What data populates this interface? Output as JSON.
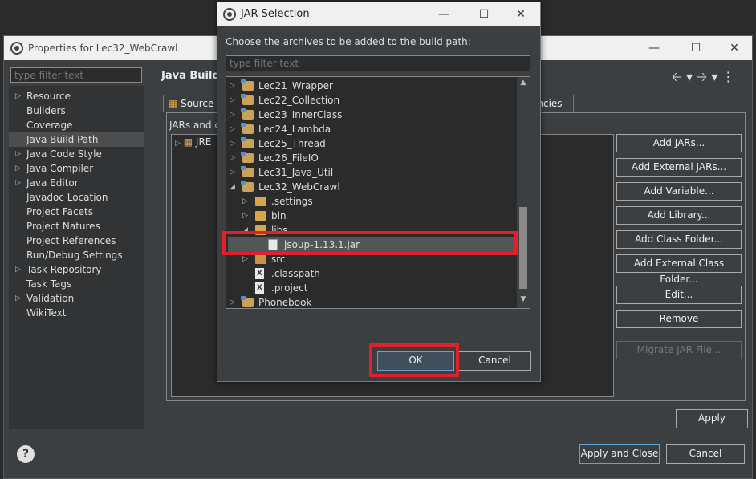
{
  "props_window": {
    "title": "Properties for Lec32_WebCrawl",
    "filter_placeholder": "type filter text",
    "nav_items": [
      {
        "label": "Resource",
        "expandable": true
      },
      {
        "label": "Builders",
        "expandable": false
      },
      {
        "label": "Coverage",
        "expandable": false
      },
      {
        "label": "Java Build Path",
        "expandable": false,
        "selected": true
      },
      {
        "label": "Java Code Style",
        "expandable": true
      },
      {
        "label": "Java Compiler",
        "expandable": true
      },
      {
        "label": "Java Editor",
        "expandable": true
      },
      {
        "label": "Javadoc Location",
        "expandable": false
      },
      {
        "label": "Project Facets",
        "expandable": false
      },
      {
        "label": "Project Natures",
        "expandable": false
      },
      {
        "label": "Project References",
        "expandable": false
      },
      {
        "label": "Run/Debug Settings",
        "expandable": false
      },
      {
        "label": "Task Repository",
        "expandable": true
      },
      {
        "label": "Task Tags",
        "expandable": false
      },
      {
        "label": "Validation",
        "expandable": true
      },
      {
        "label": "WikiText",
        "expandable": false
      }
    ],
    "page_title": "Java Build",
    "tabs": {
      "source": "Source",
      "dependencies": "encies"
    },
    "jars_label": "JARs and c",
    "jars_tree_item": "JRE",
    "side_buttons": [
      {
        "label": "Add JARs...",
        "enabled": true
      },
      {
        "label": "Add External JARs...",
        "enabled": true
      },
      {
        "label": "Add Variable...",
        "enabled": true
      },
      {
        "label": "Add Library...",
        "enabled": true
      },
      {
        "label": "Add Class Folder...",
        "enabled": true
      },
      {
        "label": "Add External Class Folder...",
        "enabled": true
      },
      {
        "label": "Edit...",
        "enabled": true
      },
      {
        "label": "Remove",
        "enabled": true
      },
      {
        "label": "Migrate JAR File...",
        "enabled": false
      }
    ],
    "apply_label": "Apply",
    "apply_close_label": "Apply and Close",
    "cancel_label": "Cancel",
    "help_glyph": "?"
  },
  "jar_dialog": {
    "title": "JAR Selection",
    "prompt": "Choose the archives to be added to the build path:",
    "filter_placeholder": "type filter text",
    "tree": [
      {
        "label": "Lec21_Wrapper",
        "icon": "project-icon",
        "depth": 0,
        "expander": "collapsed"
      },
      {
        "label": "Lec22_Collection",
        "icon": "project-icon",
        "depth": 0,
        "expander": "collapsed"
      },
      {
        "label": "Lec23_InnerClass",
        "icon": "project-icon",
        "depth": 0,
        "expander": "collapsed"
      },
      {
        "label": "Lec24_Lambda",
        "icon": "project-icon",
        "depth": 0,
        "expander": "collapsed"
      },
      {
        "label": "Lec25_Thread",
        "icon": "project-icon",
        "depth": 0,
        "expander": "collapsed"
      },
      {
        "label": "Lec26_FileIO",
        "icon": "project-icon",
        "depth": 0,
        "expander": "collapsed"
      },
      {
        "label": "Lec31_Java_Util",
        "icon": "project-icon",
        "depth": 0,
        "expander": "collapsed"
      },
      {
        "label": "Lec32_WebCrawl",
        "icon": "project-icon",
        "depth": 0,
        "expander": "expanded"
      },
      {
        "label": ".settings",
        "icon": "folder-icon",
        "depth": 1,
        "expander": "collapsed"
      },
      {
        "label": "bin",
        "icon": "folder-icon",
        "depth": 1,
        "expander": "collapsed"
      },
      {
        "label": "libs",
        "icon": "folder-icon",
        "depth": 1,
        "expander": "expanded"
      },
      {
        "label": "jsoup-1.13.1.jar",
        "icon": "jar-icon",
        "depth": 2,
        "expander": "none",
        "selected": true
      },
      {
        "label": "src",
        "icon": "src-folder-icon",
        "depth": 1,
        "expander": "collapsed"
      },
      {
        "label": ".classpath",
        "icon": "xml-file-icon",
        "depth": 1,
        "expander": "none"
      },
      {
        "label": ".project",
        "icon": "xml-file-icon",
        "depth": 1,
        "expander": "none"
      },
      {
        "label": "Phonebook",
        "icon": "project-icon",
        "depth": 0,
        "expander": "collapsed"
      }
    ],
    "ok_label": "OK",
    "cancel_label": "Cancel",
    "highlight_color": "#e0202a"
  }
}
